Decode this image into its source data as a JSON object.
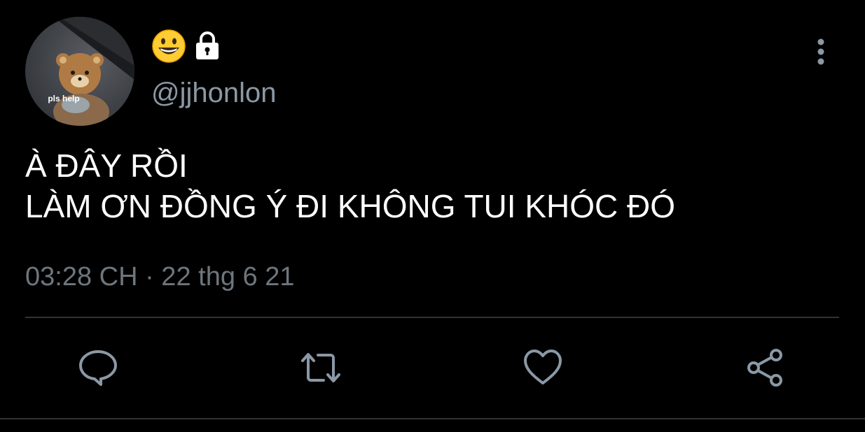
{
  "author": {
    "avatar_caption": "pls help",
    "display_name_icons": [
      "grinning-face-emoji",
      "lock-icon"
    ],
    "handle": "@jjhonlon"
  },
  "tweet": {
    "lines": [
      "À ĐÂY RỒI",
      "LÀM ƠN ĐỒNG Ý ĐI KHÔNG TUI KHÓC ĐÓ"
    ],
    "timestamp": "03:28 CH · 22 thg 6 21"
  },
  "actions": [
    "reply-icon",
    "retweet-icon",
    "like-icon",
    "share-icon"
  ],
  "colors": {
    "background": "#000000",
    "text": "#ffffff",
    "secondary_text": "#8b98a5",
    "icon": "#8b98a5",
    "divider": "#2f3336"
  }
}
